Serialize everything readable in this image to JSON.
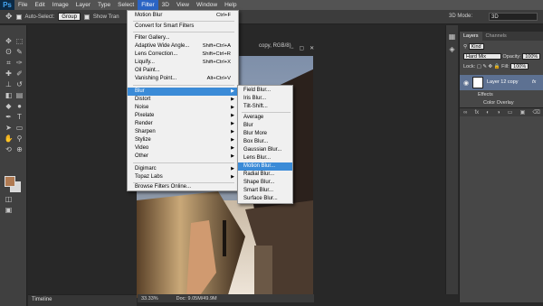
{
  "menubar": {
    "logo": "Ps",
    "items": [
      "File",
      "Edit",
      "Image",
      "Layer",
      "Type",
      "Select",
      "Filter",
      "3D",
      "View",
      "Window",
      "Help"
    ],
    "active_index": 6
  },
  "options": {
    "auto_select": "Auto-Select:",
    "group": "Group",
    "show_transform": "Show Tran",
    "mode_3d": "3D Mode:",
    "workspace": "3D"
  },
  "document": {
    "tab_title": "copy, RGB/8)",
    "zoom": "33.33%",
    "doc_info": "Doc: 9.05M/49.9M"
  },
  "timeline": {
    "label": "Timeline"
  },
  "filter_menu": {
    "items": [
      {
        "label": "Motion Blur",
        "shortcut": "Ctrl+F"
      },
      {
        "label": "Convert for Smart Filters",
        "shortcut": ""
      },
      {
        "label": "Filter Gallery...",
        "shortcut": ""
      },
      {
        "label": "Adaptive Wide Angle...",
        "shortcut": "Shift+Ctrl+A"
      },
      {
        "label": "Lens Correction...",
        "shortcut": "Shift+Ctrl+R"
      },
      {
        "label": "Liquify...",
        "shortcut": "Shift+Ctrl+X"
      },
      {
        "label": "Oil Paint...",
        "shortcut": ""
      },
      {
        "label": "Vanishing Point...",
        "shortcut": "Alt+Ctrl+V"
      },
      {
        "label": "Blur",
        "shortcut": ""
      },
      {
        "label": "Distort",
        "shortcut": ""
      },
      {
        "label": "Noise",
        "shortcut": ""
      },
      {
        "label": "Pixelate",
        "shortcut": ""
      },
      {
        "label": "Render",
        "shortcut": ""
      },
      {
        "label": "Sharpen",
        "shortcut": ""
      },
      {
        "label": "Stylize",
        "shortcut": ""
      },
      {
        "label": "Video",
        "shortcut": ""
      },
      {
        "label": "Other",
        "shortcut": ""
      },
      {
        "label": "Digimarc",
        "shortcut": ""
      },
      {
        "label": "Topaz Labs",
        "shortcut": ""
      },
      {
        "label": "Browse Filters Online...",
        "shortcut": ""
      }
    ],
    "highlighted": "Blur"
  },
  "blur_menu": {
    "items": [
      "Field Blur...",
      "Iris Blur...",
      "Tilt-Shift...",
      "Average",
      "Blur",
      "Blur More",
      "Box Blur...",
      "Gaussian Blur...",
      "Lens Blur...",
      "Motion Blur...",
      "Radial Blur...",
      "Shape Blur...",
      "Smart Blur...",
      "Surface Blur..."
    ],
    "highlighted": "Motion Blur..."
  },
  "layers": {
    "tabs": [
      "Layers",
      "Channels"
    ],
    "kind": "Kind",
    "blend_mode": "Hard Mix",
    "opacity_label": "Opacity:",
    "opacity": "100%",
    "lock_label": "Lock:",
    "fill_label": "Fill:",
    "fill": "100%",
    "layer_name": "Layer 12 copy",
    "fx": "fx",
    "effects": "Effects",
    "color_overlay": "Color Overlay"
  },
  "colors": {
    "foreground": "#b07a52",
    "background": "#d8d8d8",
    "highlight": "#3b8bd7"
  }
}
